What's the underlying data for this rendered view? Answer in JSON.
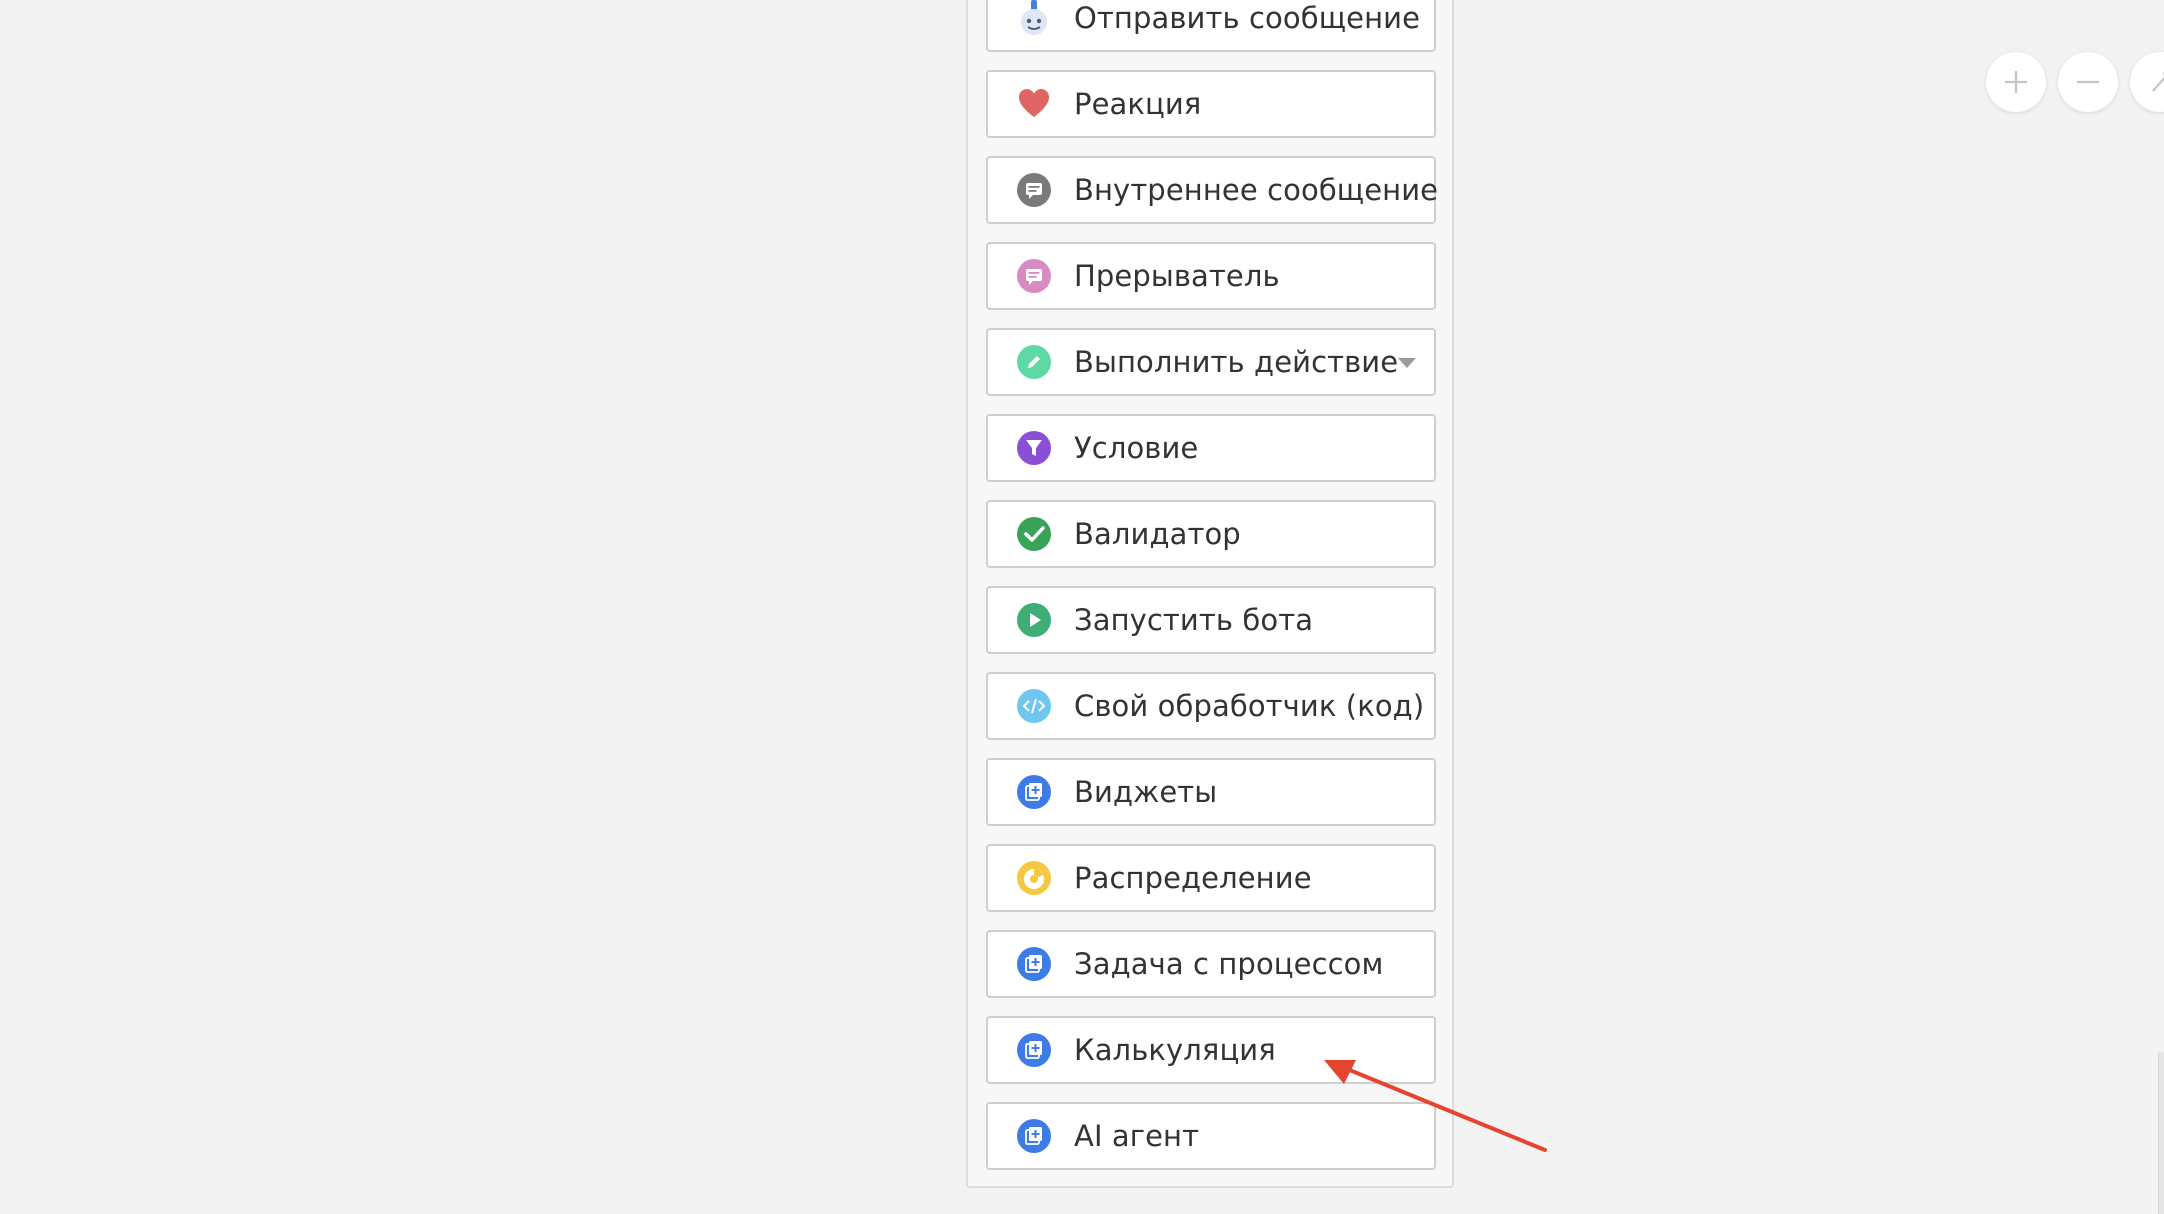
{
  "palette": {
    "items": [
      {
        "label": "Отправить сообщение",
        "icon": "robot-icon"
      },
      {
        "label": "Реакция",
        "icon": "heart-icon"
      },
      {
        "label": "Внутреннее сообщение",
        "icon": "chat-bubble-gray-icon"
      },
      {
        "label": "Прерыватель",
        "icon": "chat-bubble-pink-icon"
      },
      {
        "label": "Выполнить действие",
        "icon": "pencil-icon",
        "has_dropdown": true
      },
      {
        "label": "Условие",
        "icon": "funnel-icon"
      },
      {
        "label": "Валидатор",
        "icon": "checkmark-icon"
      },
      {
        "label": "Запустить бота",
        "icon": "play-icon"
      },
      {
        "label": "Свой обработчик (код)",
        "icon": "code-icon"
      },
      {
        "label": "Виджеты",
        "icon": "widget-plus-icon"
      },
      {
        "label": "Распределение",
        "icon": "distribution-icon"
      },
      {
        "label": "Задача с процессом",
        "icon": "widget-plus-icon"
      },
      {
        "label": "Калькуляция",
        "icon": "widget-plus-icon"
      },
      {
        "label": "AI агент",
        "icon": "widget-plus-icon"
      }
    ]
  },
  "zoom_controls": {
    "buttons": [
      "zoom-in",
      "zoom-out",
      "magic-wand"
    ]
  },
  "colors": {
    "heart": "#e06666",
    "gray_bubble": "#7a7a7a",
    "pink_bubble": "#d88ac3",
    "pencil": "#5fd9a4",
    "funnel": "#8a4fd6",
    "check": "#3aa35a",
    "play": "#3fae76",
    "code": "#6fc6ee",
    "widget": "#3d7be6",
    "distribution": "#f5c842",
    "annotation_arrow": "#e5452e"
  },
  "annotation": {
    "points_to": "Калькуляция"
  }
}
